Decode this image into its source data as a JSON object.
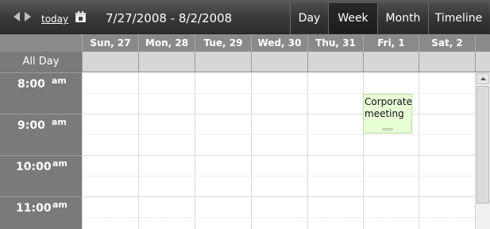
{
  "toolbar": {
    "nav_icon": "prev-next-arrows-icon",
    "today_label": "today",
    "calendar_icon": "calendar-icon",
    "date_range": "7/27/2008 - 8/2/2008",
    "views": [
      "Day",
      "Week",
      "Month",
      "Timeline"
    ],
    "active_view": "Week"
  },
  "grid": {
    "days": [
      "Sun, 27",
      "Mon, 28",
      "Tue, 29",
      "Wed, 30",
      "Thu, 31",
      "Fri, 1",
      "Sat, 2"
    ],
    "all_day_label": "All Day",
    "times": [
      {
        "hour": "8:00",
        "ampm": "am"
      },
      {
        "hour": "9:00",
        "ampm": "am"
      },
      {
        "hour": "10:00",
        "ampm": "am"
      },
      {
        "hour": "11:00",
        "ampm": "am"
      }
    ]
  },
  "events": [
    {
      "title": "Corporate meeting",
      "day": "Fri, 1",
      "color": "#e8ffd6"
    }
  ],
  "colors": {
    "toolbar": "#3a3a3a",
    "header": "#8a8a8a",
    "time_column": "#7a7a7a",
    "all_day_row": "#d4d4d4",
    "event_fill": "#e8ffd6"
  }
}
